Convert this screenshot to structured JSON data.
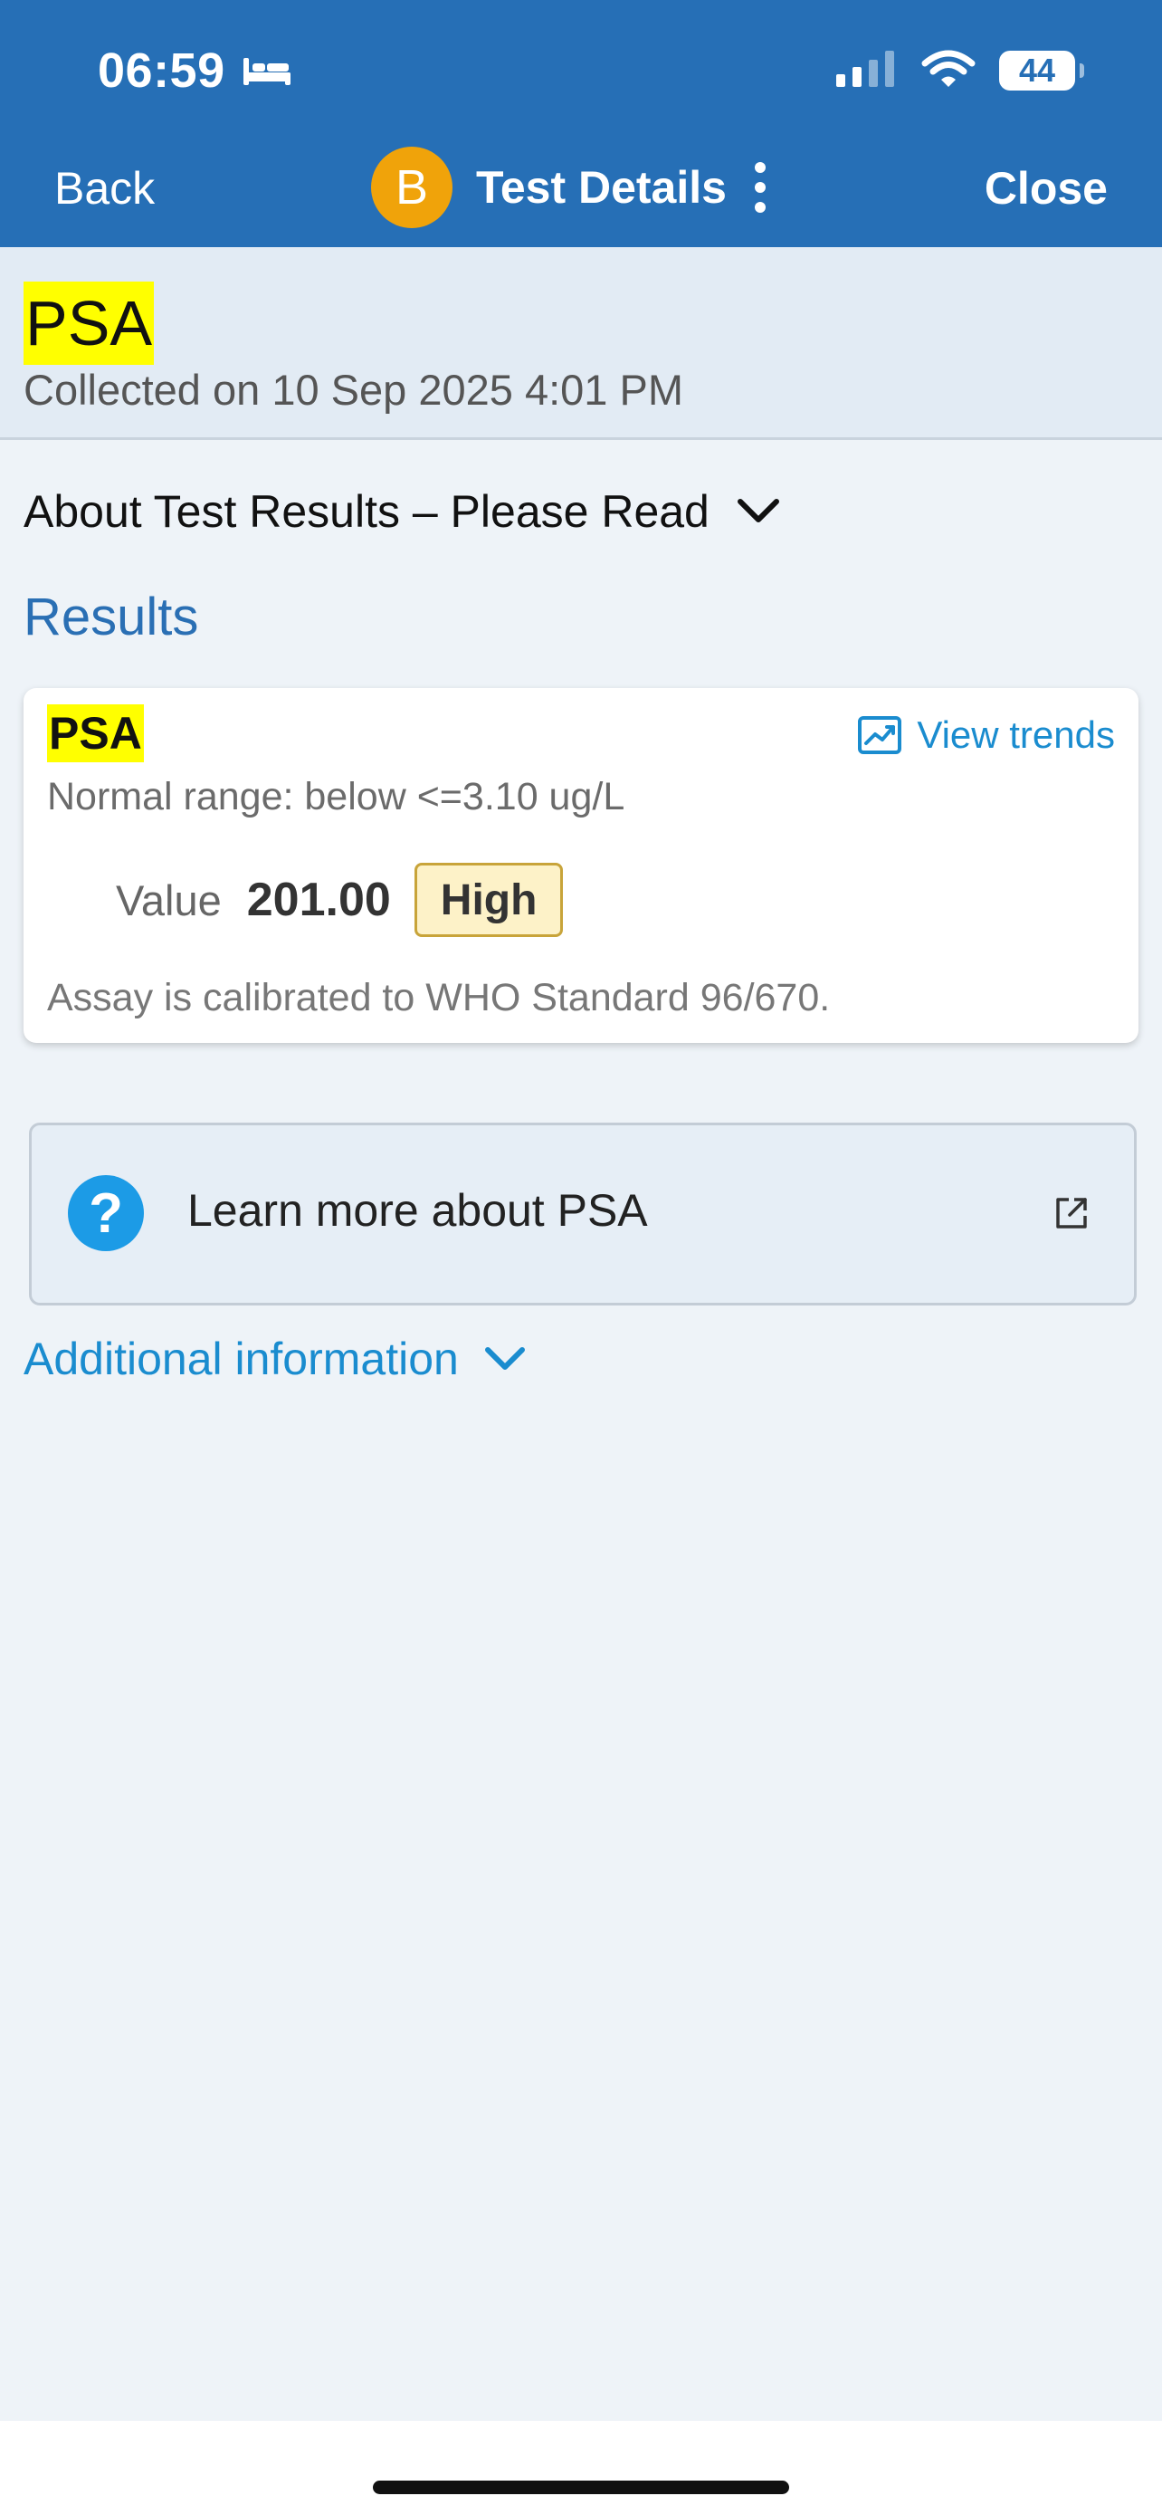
{
  "status_bar": {
    "time": "06:59",
    "battery": "44",
    "icons": [
      "bed-icon",
      "signal-icon",
      "wifi-icon",
      "battery-icon"
    ]
  },
  "nav": {
    "back_label": "Back",
    "avatar_letter": "B",
    "title": "Test Details",
    "close_label": "Close",
    "icons": [
      "more-vertical-icon"
    ]
  },
  "test": {
    "name": "PSA",
    "collected": "Collected on 10 Sep 2025 4:01 PM"
  },
  "about": {
    "label": "About Test Results – Please Read",
    "icon": "chevron-down-icon"
  },
  "results": {
    "heading": "Results",
    "card": {
      "name": "PSA",
      "view_trends_label": "View trends",
      "trends_icon": "trend-chart-icon",
      "normal_range": "Normal range: below <=3.10 ug/L",
      "value_label": "Value",
      "value": "201.00",
      "flag": "High",
      "note": "Assay is calibrated to WHO Standard 96/670."
    }
  },
  "learn_more": {
    "label": "Learn more about PSA",
    "icons": [
      "help-icon",
      "external-link-icon"
    ]
  },
  "additional_info": {
    "label": "Additional information",
    "icon": "chevron-down-icon"
  },
  "colors": {
    "header_blue": "#266fb6",
    "highlight_yellow": "#ffff00",
    "link_blue": "#1a8ccf",
    "avatar_orange": "#f0a30a",
    "flag_bg": "#fdf2c8",
    "flag_border": "#c8a43a"
  }
}
